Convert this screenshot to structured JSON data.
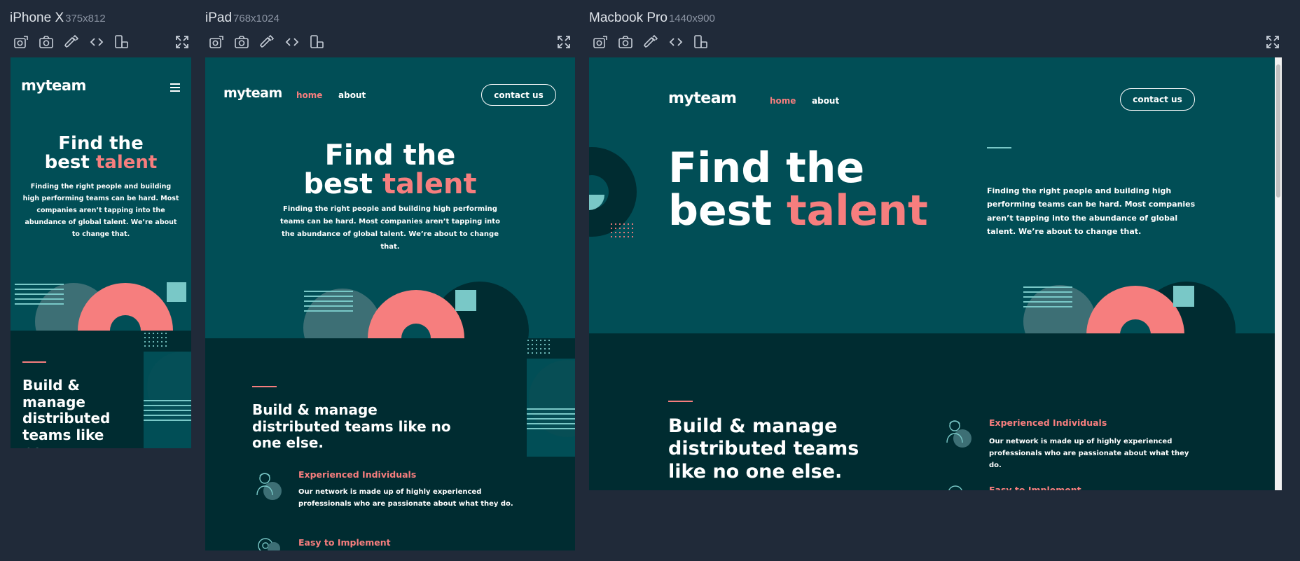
{
  "devices": [
    {
      "name": "iPhone X",
      "dims": "375x812"
    },
    {
      "name": "iPad",
      "dims": "768x1024"
    },
    {
      "name": "Macbook Pro",
      "dims": "1440x900"
    }
  ],
  "icons": [
    "rotate-icon",
    "screenshot-icon",
    "eyedropper-icon",
    "code-icon",
    "device-orientation-icon",
    "fullscreen-icon"
  ],
  "site": {
    "logo": "myteam",
    "nav": {
      "home": "home",
      "about": "about"
    },
    "contact": "contact us",
    "hero": {
      "line1": "Find the",
      "line2_plain": "best",
      "line2_accent": "talent",
      "description": "Finding the right people and building high performing teams can be hard. Most companies aren’t tapping into the abundance of global talent. We’re about to change that."
    },
    "section": {
      "title": "Build & manage distributed teams like no one else.",
      "title_mobile_clip": "Build & manage distributed teams like no"
    },
    "features": [
      {
        "title": "Experienced Individuals",
        "description": "Our network is made up of highly experienced professionals who are passionate about what they do."
      },
      {
        "title": "Easy to Implement",
        "description": ""
      }
    ]
  },
  "colors": {
    "page_bg": "#202a39",
    "teal": "#014e56",
    "dark_teal": "#002c31",
    "coral": "#f67e7e",
    "light_blue": "#79c8c7"
  }
}
